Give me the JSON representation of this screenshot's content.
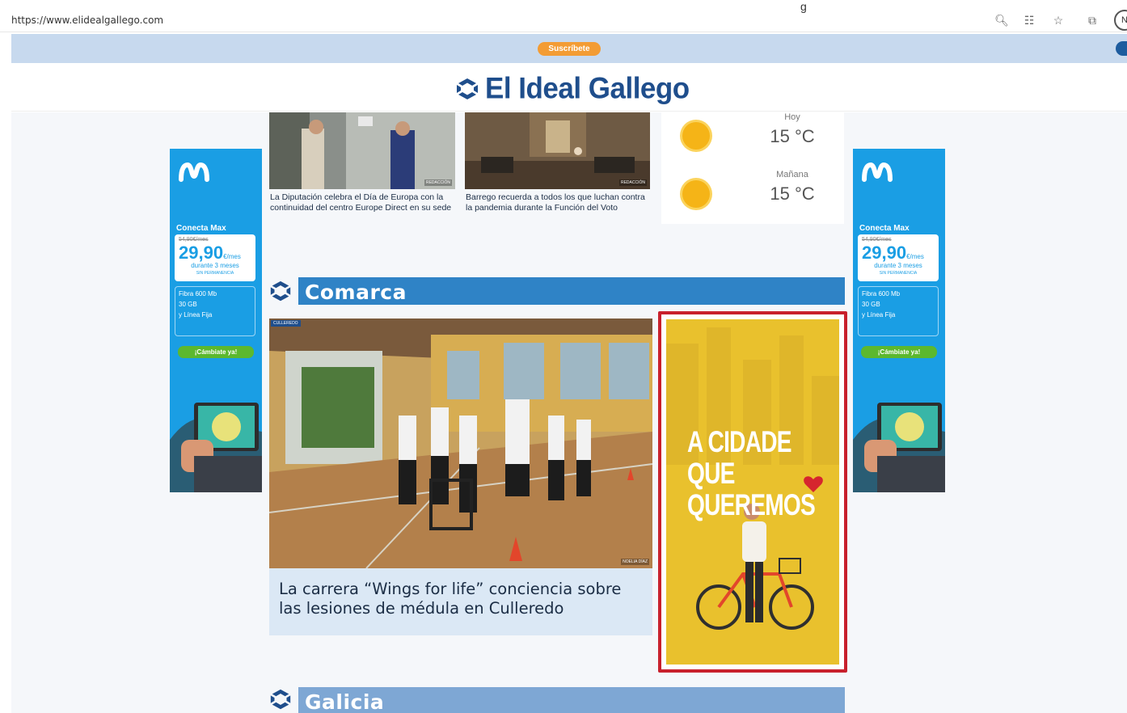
{
  "browser": {
    "url": "https://www.elidealgallego.com",
    "tab_fragment": "g"
  },
  "topbar": {
    "subscribe_label": "Suscríbete"
  },
  "site": {
    "name": "El Ideal Gallego",
    "brand_color": "#1f4e8c"
  },
  "side_ads": {
    "product": "Conecta Max",
    "old_price": "54,90€/mes",
    "price": "29,90",
    "price_unit": "€/mes",
    "duration": "durante 3 meses",
    "no_permanence": "SIN PERMANENCIA",
    "features": [
      "Fibra 600 Mb",
      "30 GB",
      "y Línea Fija"
    ],
    "cta": "¡Cámbiate ya!"
  },
  "stories": [
    {
      "caption": "La Diputación celebra el Día de Europa con la continuidad del centro Europe Direct en su sede",
      "credit": "REDACCIÓN"
    },
    {
      "caption": "Barrego recuerda a todos los que luchan contra la pandemia durante la Función del Voto",
      "credit": "REDACCIÓN"
    }
  ],
  "weather": {
    "today_label": "Hoy",
    "today_temp": "15 °C",
    "tomorrow_label": "Mañana",
    "tomorrow_temp": "15 °C"
  },
  "sections": {
    "comarca": "Comarca",
    "galicia": "Galicia",
    "header_color": "#2f83c6"
  },
  "feature": {
    "tag": "CULLEREDO",
    "credit": "NOELIA DÍAZ",
    "title": "La carrera “Wings for life” conciencia sobre las lesiones de médula en Culleredo"
  },
  "yellow_ad": {
    "headline_lines": [
      "A CIDADE",
      "QUE",
      "QUEREMOS"
    ],
    "bg_color": "#e9c12d",
    "frame_color": "#c8202c"
  }
}
